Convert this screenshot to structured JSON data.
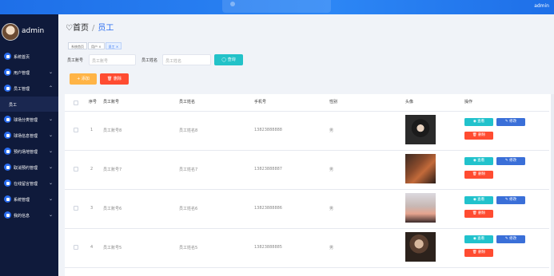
{
  "topbar": {
    "user": "admin"
  },
  "brand": {
    "name": "admin"
  },
  "menu": [
    {
      "label": "系统首页",
      "icon": "home-icon",
      "expand": false
    },
    {
      "label": "用户管理",
      "icon": "grid-icon",
      "expand": true
    },
    {
      "label": "员工管理",
      "icon": "grid-icon",
      "expand": true,
      "open": true
    },
    {
      "label": "员工",
      "sub": true
    },
    {
      "label": "球场分类管理",
      "icon": "grid-icon",
      "expand": true
    },
    {
      "label": "球场信息管理",
      "icon": "grid-icon",
      "expand": true
    },
    {
      "label": "预约场地管理",
      "icon": "shield-icon",
      "expand": true
    },
    {
      "label": "取消预约管理",
      "icon": "grid-icon",
      "expand": true
    },
    {
      "label": "在线留言管理",
      "icon": "grid-icon",
      "expand": true
    },
    {
      "label": "系统管理",
      "icon": "user-icon",
      "expand": true
    },
    {
      "label": "我的信息",
      "icon": "grid-icon",
      "expand": true
    }
  ],
  "breadcrumb": {
    "home": "♡首页",
    "sep": "/",
    "current": "员工"
  },
  "tags": [
    "系统首页",
    "用户 ×",
    "员工 ×"
  ],
  "search": {
    "label1": "员工账号",
    "placeholder1": "员工账号",
    "label2": "员工姓名",
    "placeholder2": "员工姓名",
    "button": "◯ 查询"
  },
  "actions": {
    "add": "+ 添加",
    "delete": "🗑 删除"
  },
  "table": {
    "headers": [
      "序号",
      "员工账号",
      "员工姓名",
      "手机号",
      "性别",
      "头像",
      "操作"
    ],
    "rows": [
      {
        "no": "1",
        "account": "员工账号8",
        "name": "员工姓名8",
        "phone": "13823888888",
        "gender": "男"
      },
      {
        "no": "2",
        "account": "员工账号7",
        "name": "员工姓名7",
        "phone": "13823888887",
        "gender": "男"
      },
      {
        "no": "3",
        "account": "员工账号6",
        "name": "员工姓名6",
        "phone": "13823888886",
        "gender": "男"
      },
      {
        "no": "4",
        "account": "员工账号5",
        "name": "员工姓名5",
        "phone": "13823888885",
        "gender": "男"
      }
    ],
    "btn_view": "◉ 查看",
    "btn_edit": "✎ 修改",
    "btn_delete": "🗑 删除"
  }
}
